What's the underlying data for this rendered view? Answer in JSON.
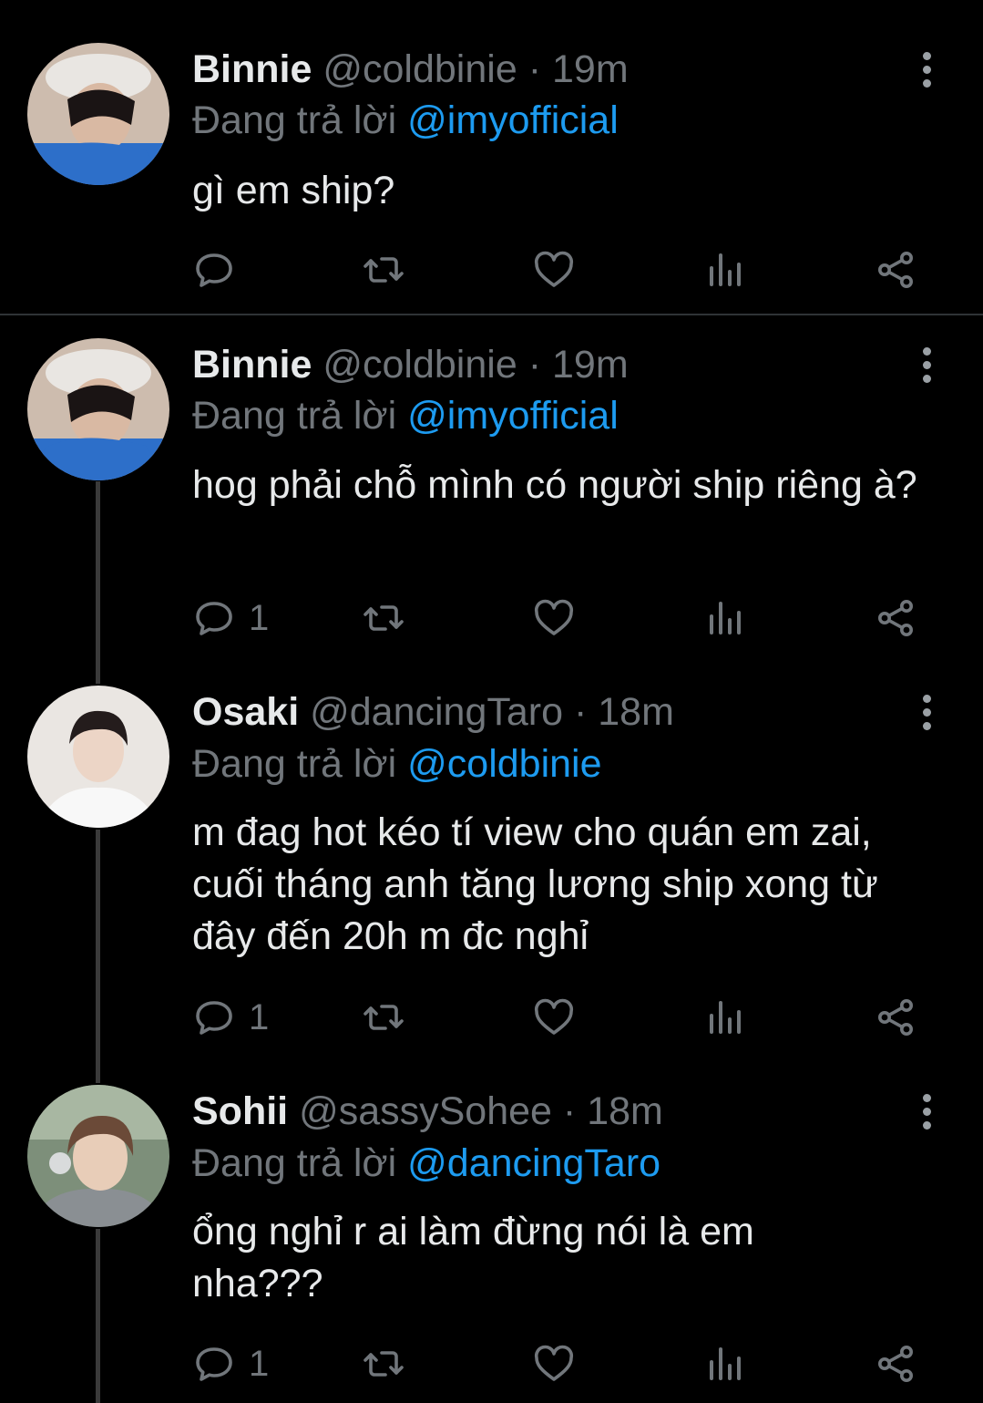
{
  "tweets": [
    {
      "name": "Binnie",
      "handle": "@coldbinie",
      "dot": "·",
      "time": "19m",
      "reply_prefix": "Đang trả lời",
      "reply_to": "@imyofficial",
      "text": "gì em ship?",
      "reply_count": ""
    },
    {
      "name": "Binnie",
      "handle": "@coldbinie",
      "dot": "·",
      "time": "19m",
      "reply_prefix": "Đang trả lời",
      "reply_to": "@imyofficial",
      "text": "hog phải chỗ mình có người ship riêng à?",
      "reply_count": "1"
    },
    {
      "name": "Osaki",
      "handle": "@dancingTaro",
      "dot": "·",
      "time": "18m",
      "reply_prefix": "Đang trả lời",
      "reply_to": "@coldbinie",
      "text": "m đag hot kéo tí view cho quán em zai, cuối tháng anh tăng lương ship xong từ đây đến 20h m đc nghỉ",
      "reply_count": "1"
    },
    {
      "name": "Sohii",
      "handle": "@sassySohee",
      "dot": "·",
      "time": "18m",
      "reply_prefix": "Đang trả lời",
      "reply_to": "@dancingTaro",
      "text": "ổng nghỉ r ai làm đừng nói là em nha???",
      "reply_count": "1"
    }
  ],
  "icons": {
    "reply": "reply-icon",
    "retweet": "retweet-icon",
    "like": "heart-icon",
    "views": "analytics-icon",
    "share": "share-icon",
    "more": "more-vertical-icon"
  },
  "colors": {
    "background": "#000000",
    "text": "#e7e9ea",
    "muted": "#71767b",
    "mention": "#1d9bf0"
  }
}
